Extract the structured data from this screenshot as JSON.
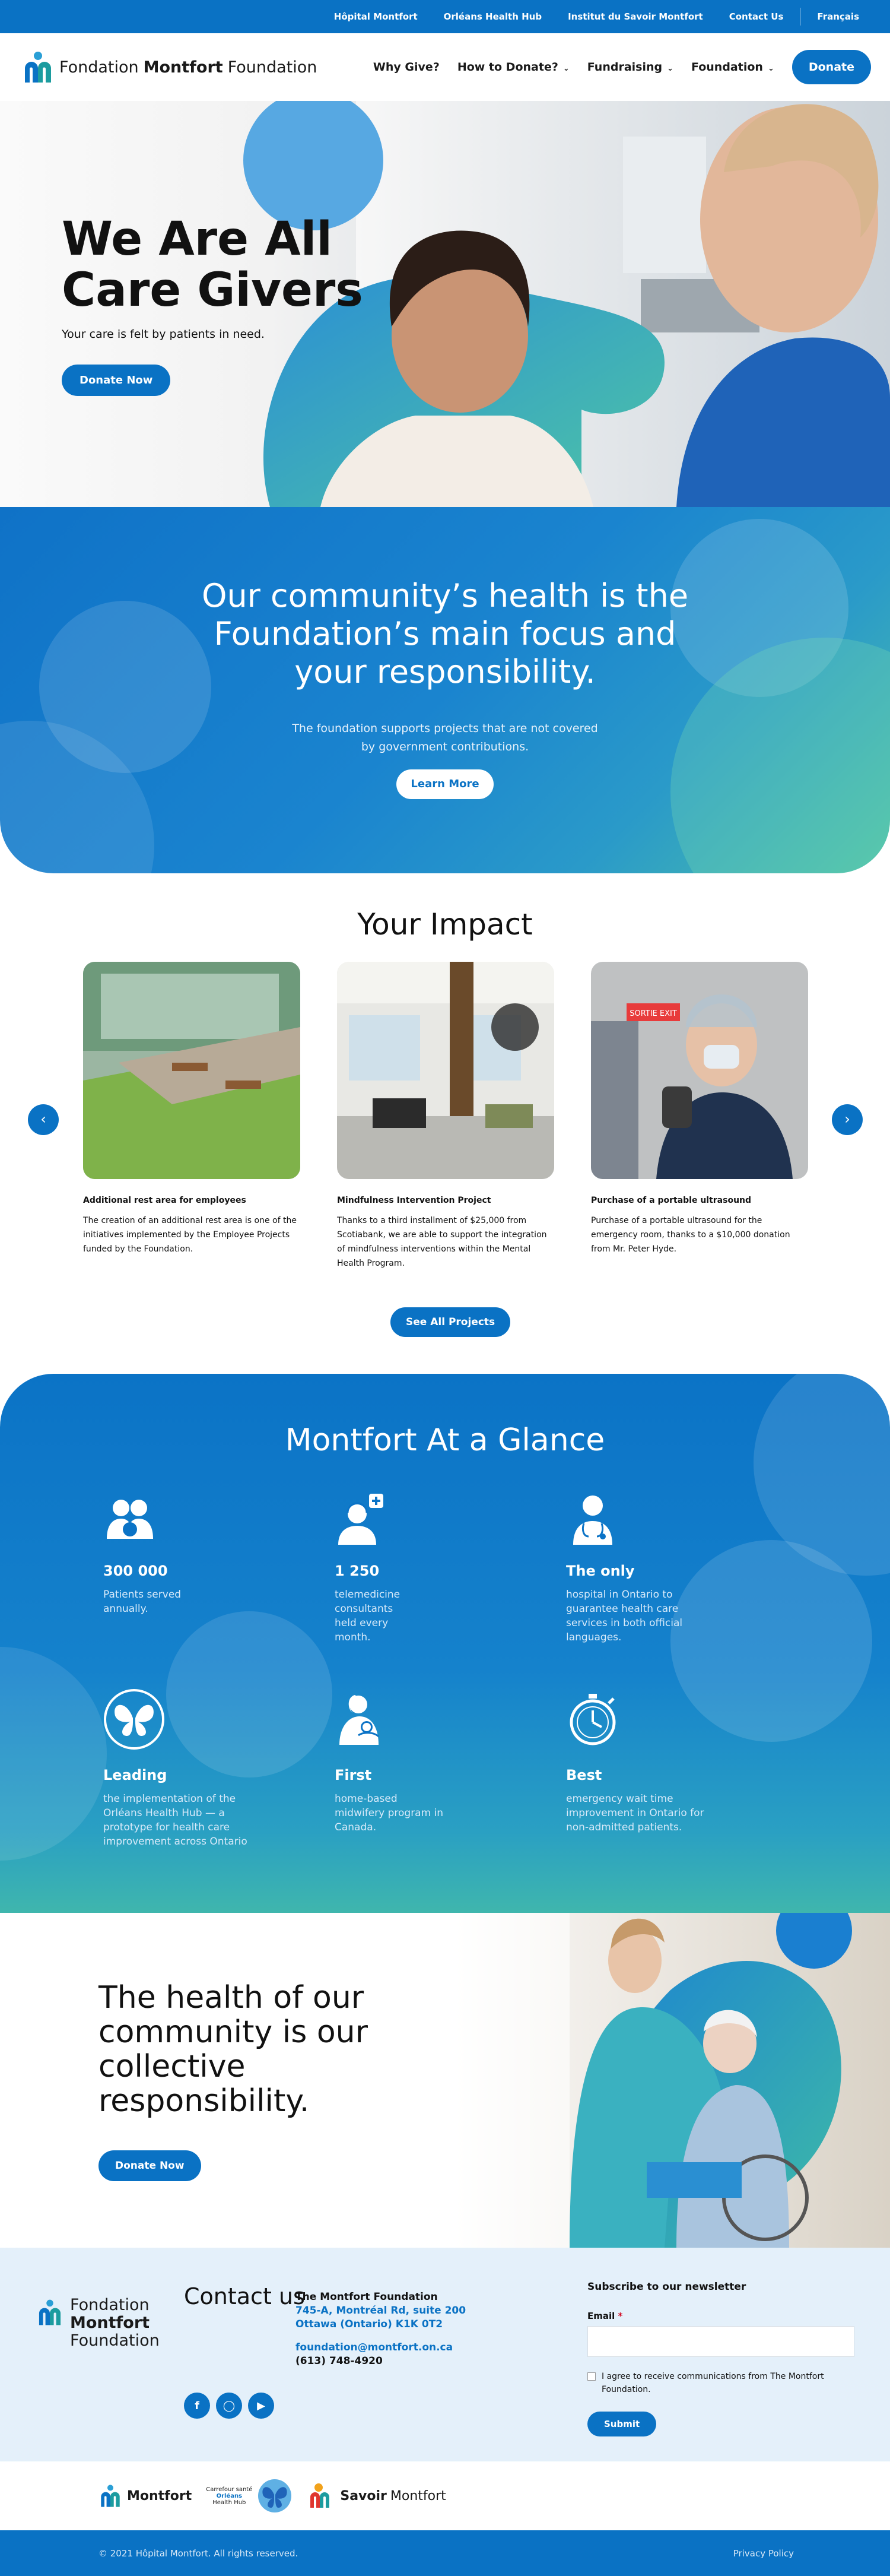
{
  "topbar": {
    "links": [
      "Hôpital Montfort",
      "Orléans Health Hub",
      "Institut du Savoir Montfort",
      "Contact Us"
    ],
    "language": "Français"
  },
  "header": {
    "logo_text_1": "Fondation",
    "logo_text_2": "Montfort",
    "logo_text_3": "Foundation",
    "nav": [
      "Why Give?",
      "How to Donate?",
      "Fundraising",
      "Foundation"
    ],
    "donate": "Donate"
  },
  "hero": {
    "title": "We Are All Care Givers",
    "subtitle": "Your care is felt by patients in need.",
    "cta": "Donate Now"
  },
  "focus": {
    "title_line1": "Our community’s health is the",
    "title_line2": "Foundation’s main focus and",
    "title_line3": "your responsibility.",
    "text_line1": "The foundation supports projects that are not covered",
    "text_line2": "by government contributions.",
    "cta": "Learn More"
  },
  "impact": {
    "title": "Your Impact",
    "cards": [
      {
        "title": "Additional rest area for employees",
        "text": "The creation of an additional rest area is one of the initiatives implemented by the Employee Projects funded by the Foundation."
      },
      {
        "title": "Mindfulness Intervention Project",
        "text": "Thanks to a third installment of $25,000 from Scotiabank, we are able to support the integration of mindfulness interventions within the Mental Health Program."
      },
      {
        "title": "Purchase of a portable ultrasound",
        "text": "Purchase of a portable ultrasound for the emergency room, thanks to a $10,000 donation from Mr. Peter Hyde."
      }
    ],
    "see_all": "See All Projects",
    "exit_sign": "SORTIE EXIT"
  },
  "glance": {
    "title": "Montfort At a Glance",
    "stats": [
      {
        "icon": "patients-icon",
        "value": "300 000",
        "text": "Patients served annually."
      },
      {
        "icon": "telemedicine-icon",
        "value": "1 250",
        "text": "telemedicine consultants held every month."
      },
      {
        "icon": "doctor-icon",
        "value": "The only",
        "text": "hospital in Ontario to guarantee health care services in both official languages."
      },
      {
        "icon": "butterfly-icon",
        "value": "Leading",
        "text": "the implementation of the Orléans Health Hub — a prototype for health care improvement across Ontario"
      },
      {
        "icon": "midwife-icon",
        "value": "First",
        "text": "home-based midwifery program in Canada."
      },
      {
        "icon": "stopwatch-icon",
        "value": "Best",
        "text": "emergency wait time improvement in Ontario for non-admitted patients."
      }
    ]
  },
  "responsibility": {
    "title": "The health of our community is our collective responsibility.",
    "cta": "Donate Now"
  },
  "contact": {
    "logo_line1": "Fondation",
    "logo_line2": "Montfort",
    "logo_line3": "Foundation",
    "heading": "Contact us",
    "org": "The Montfort Foundation",
    "address1": "745-A, Montréal Rd, suite 200",
    "address2": "Ottawa (Ontario) K1K 0T2",
    "email": "foundation@montfort.on.ca",
    "phone": "(613) 748-4920",
    "newsletter_title": "Subscribe to our newsletter",
    "email_label": "Email",
    "required_mark": "*",
    "consent": "I agree to receive communications from The Montfort Foundation.",
    "submit": "Submit"
  },
  "partners": {
    "montfort": "Montfort",
    "hub_line1": "Carrefour santé",
    "hub_line2": "Orléans",
    "hub_line3": "Health Hub",
    "savoir_1": "Savoir",
    "savoir_2": "Montfort"
  },
  "footer": {
    "copyright": "© 2021 Hôpital Montfort. All rights reserved.",
    "privacy": "Privacy Policy"
  },
  "colors": {
    "primary": "#0a72c4",
    "teal": "#3fb6ad",
    "light": "#e4f0fa"
  }
}
